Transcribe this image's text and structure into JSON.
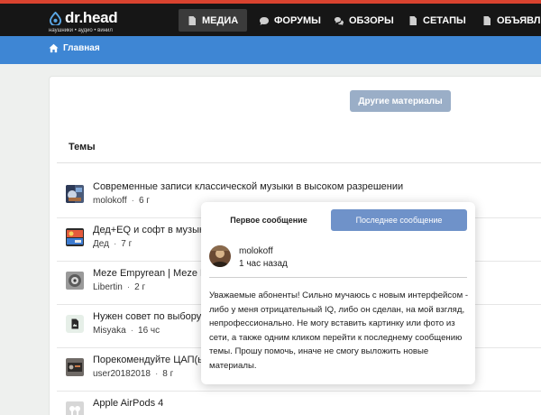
{
  "header": {
    "logo_text": "dr.head",
    "logo_sub": "наушники • аудио • винил",
    "nav": [
      {
        "label": "Медиа",
        "icon": "document-icon",
        "active": true
      },
      {
        "label": "Форумы",
        "icon": "chat-bubble-icon"
      },
      {
        "label": "Обзоры",
        "icon": "chat-bubbles-icon"
      },
      {
        "label": "Сетапы",
        "icon": "document-icon"
      },
      {
        "label": "Объявлени",
        "icon": "document-icon"
      }
    ]
  },
  "breadcrumb": {
    "home_label": "Главная",
    "icon": "home-icon"
  },
  "main": {
    "other_materials_label": "Другие материалы",
    "section_title": "Темы",
    "topics": [
      {
        "title": "Современные записи классической музыки в высоком разрешении",
        "author": "molokoff",
        "age": "6 г"
      },
      {
        "title": "Дед+EQ и софт в музыке...",
        "author": "Дед",
        "age": "7 г"
      },
      {
        "title": "Meze Empyrean | Meze Elite",
        "author": "Libertin",
        "age": "2 г"
      },
      {
        "title": "Нужен совет по выбору син",
        "author": "Misyaka",
        "age": "16 чс"
      },
      {
        "title": "Порекомендуйте ЦАП(ы) ча",
        "author": "user20182018",
        "age": "8 г"
      },
      {
        "title": "Apple AirPods 4",
        "author": "",
        "age": ""
      }
    ]
  },
  "popup": {
    "tab_first": "Первое сообщение",
    "tab_last": "Последнее сообщение",
    "author": "molokoff",
    "time": "1 час назад",
    "body": "Уважаемые абоненты! Сильно мучаюсь с новым интерфейсом - либо у меня отрицательный IQ, либо он сделан, на мой взгляд, непрофессионально. Не могу вставить картинку или фото из сети, а также одним кликом перейти к последнему сообщению темы. Прошу помочь, иначе не смогу выложить новые материалы."
  },
  "colors": {
    "red_strip": "#d9432f",
    "nav_bg": "#161616",
    "breadcrumb_bg": "#3e86d4",
    "button_muted": "#9aaec7",
    "tab_active": "#6f92c9"
  }
}
